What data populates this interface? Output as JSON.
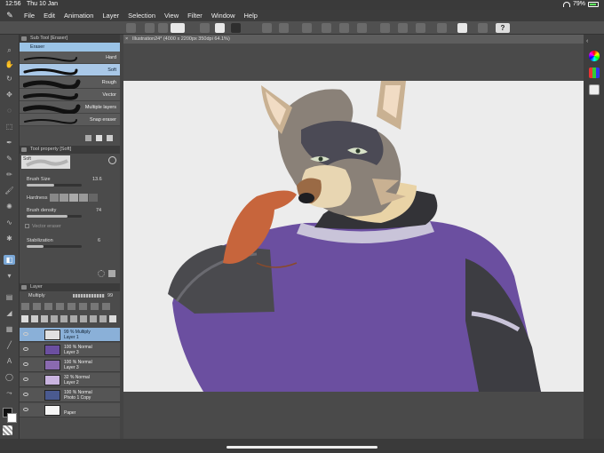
{
  "status": {
    "time": "12:56",
    "date": "Thu 10 Jan",
    "battery": "79%"
  },
  "menu": [
    "File",
    "Edit",
    "Animation",
    "Layer",
    "Selection",
    "View",
    "Filter",
    "Window",
    "Help"
  ],
  "subtool": {
    "header": "Sub Tool [Eraser]",
    "tab": "Eraser",
    "brushes": [
      "Hard",
      "Soft",
      "Rough",
      "Vector",
      "Multiple layers",
      "Snap eraser"
    ],
    "selected_index": 1
  },
  "tool_property": {
    "header": "Tool property [Soft]",
    "preview_label": "Soft",
    "brush_size_label": "Brush Size",
    "brush_size_value": "13.6",
    "hardness_label": "Hardness",
    "brush_density_label": "Brush density",
    "brush_density_value": "74",
    "vector_eraser_label": "Vector eraser",
    "stabilization_label": "Stabilization",
    "stabilization_value": "6",
    "brush_size_level": 0.5,
    "brush_density_level": 0.74,
    "stabilization_level": 0.3
  },
  "layer_panel": {
    "header": "Layer",
    "blend_mode": "Multiply",
    "opacity": "99",
    "layers": [
      {
        "line1": "99 % Multiply",
        "line2": "Layer 1",
        "selected": true
      },
      {
        "line1": "100 % Normal",
        "line2": "Layer 3",
        "selected": false
      },
      {
        "line1": "100 % Normal",
        "line2": "Layer 3",
        "selected": false
      },
      {
        "line1": "32 % Normal",
        "line2": "Layer 2",
        "selected": false
      },
      {
        "line1": "100 % Normal",
        "line2": "Photo 1 Copy",
        "selected": false
      },
      {
        "line1": "",
        "line2": "Paper",
        "selected": false
      }
    ]
  },
  "document": {
    "title": "Illustration24* (4000 x 2200px 350dpi 64.1%)"
  },
  "help_label": "?"
}
